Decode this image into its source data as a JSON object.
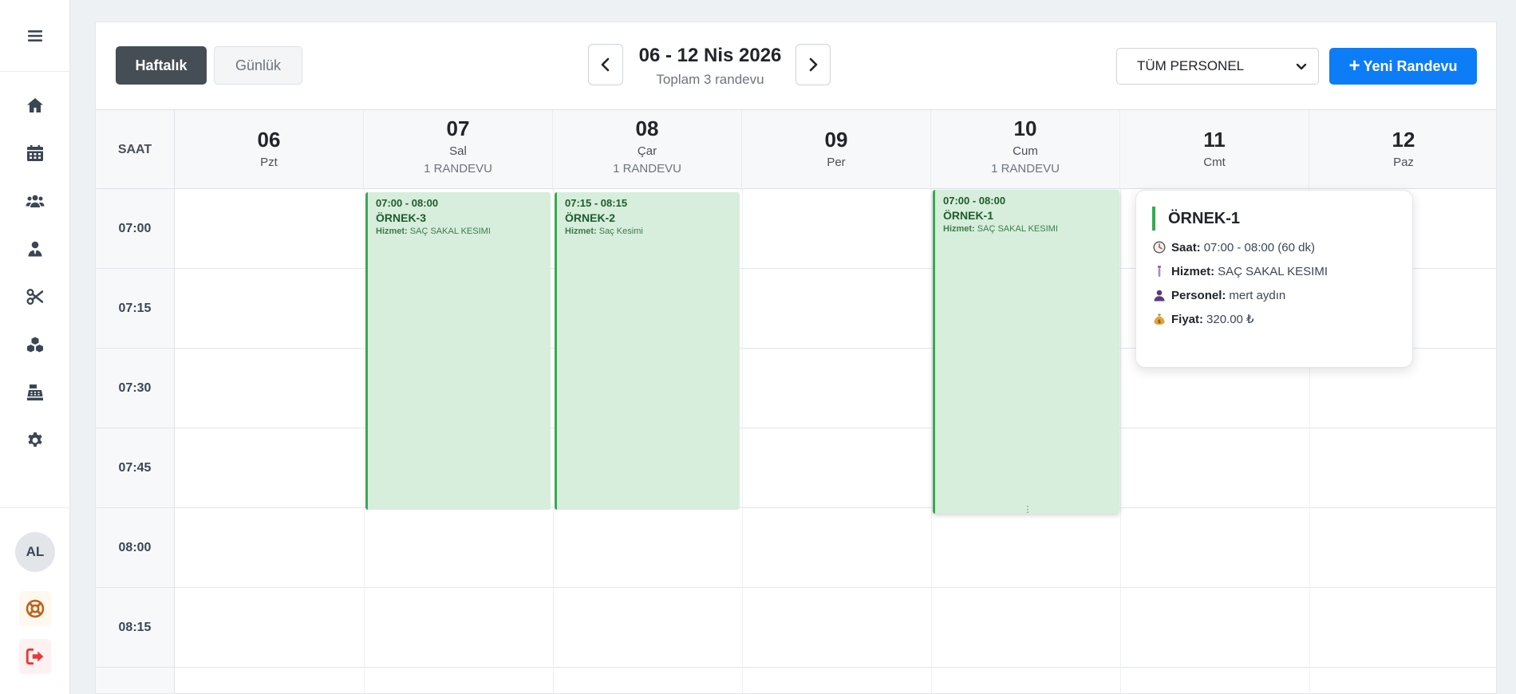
{
  "sidebar": {
    "menu_icon": "hamburger-icon",
    "items": [
      {
        "icon": "home-icon"
      },
      {
        "icon": "calendar-icon"
      },
      {
        "icon": "users-icon"
      },
      {
        "icon": "user-tie-icon"
      },
      {
        "icon": "scissors-icon"
      },
      {
        "icon": "boxes-icon"
      },
      {
        "icon": "cash-register-icon"
      },
      {
        "icon": "gear-icon"
      }
    ],
    "avatar_initials": "AL",
    "help_icon": "life-ring-icon",
    "logout_icon": "sign-out-icon"
  },
  "toolbar": {
    "view_weekly": "Haftalık",
    "view_daily": "Günlük",
    "range_title": "06 - 12 Nis 2026",
    "range_subtitle": "Toplam 3 randevu",
    "staff_selected": "TÜM PERSONEL",
    "new_appointment_label": "Yeni Randevu"
  },
  "calendar": {
    "time_header": "SAAT",
    "days": [
      {
        "num": "06",
        "name": "Pzt",
        "count": ""
      },
      {
        "num": "07",
        "name": "Sal",
        "count": "1 RANDEVU"
      },
      {
        "num": "08",
        "name": "Çar",
        "count": "1 RANDEVU"
      },
      {
        "num": "09",
        "name": "Per",
        "count": ""
      },
      {
        "num": "10",
        "name": "Cum",
        "count": "1 RANDEVU"
      },
      {
        "num": "11",
        "name": "Cmt",
        "count": ""
      },
      {
        "num": "12",
        "name": "Paz",
        "count": ""
      }
    ],
    "times": [
      "07:00",
      "07:15",
      "07:30",
      "07:45",
      "08:00",
      "08:15"
    ],
    "events": [
      {
        "day": "07",
        "time": "07:00 - 08:00",
        "title": "ÖRNEK-3",
        "service_label": "Hizmet:",
        "service": "SAÇ SAKAL KESIMI"
      },
      {
        "day": "08",
        "time": "07:15 - 08:15",
        "title": "ÖRNEK-2",
        "service_label": "Hizmet:",
        "service": "Saç Kesimi"
      },
      {
        "day": "10",
        "time": "07:00 - 08:00",
        "title": "ÖRNEK-1",
        "service_label": "Hizmet:",
        "service": "SAÇ SAKAL KESIMI"
      }
    ]
  },
  "tooltip": {
    "title": "ÖRNEK-1",
    "rows": [
      {
        "icon": "clock-icon",
        "label": "Saat:",
        "value": "07:00 - 08:00 (60 dk)"
      },
      {
        "icon": "service-icon",
        "label": "Hizmet:",
        "value": "SAÇ SAKAL KESIMI"
      },
      {
        "icon": "person-icon",
        "label": "Personel:",
        "value": "mert aydın"
      },
      {
        "icon": "money-bag-icon",
        "label": "Fiyat:",
        "value": "320.00 ₺"
      }
    ]
  },
  "colors": {
    "primary": "#0d7cf7",
    "dark_button": "#454d55",
    "event_bg": "#d6eedb",
    "event_border": "#3aa753",
    "logout": "#e53935",
    "help": "#c0611a"
  }
}
